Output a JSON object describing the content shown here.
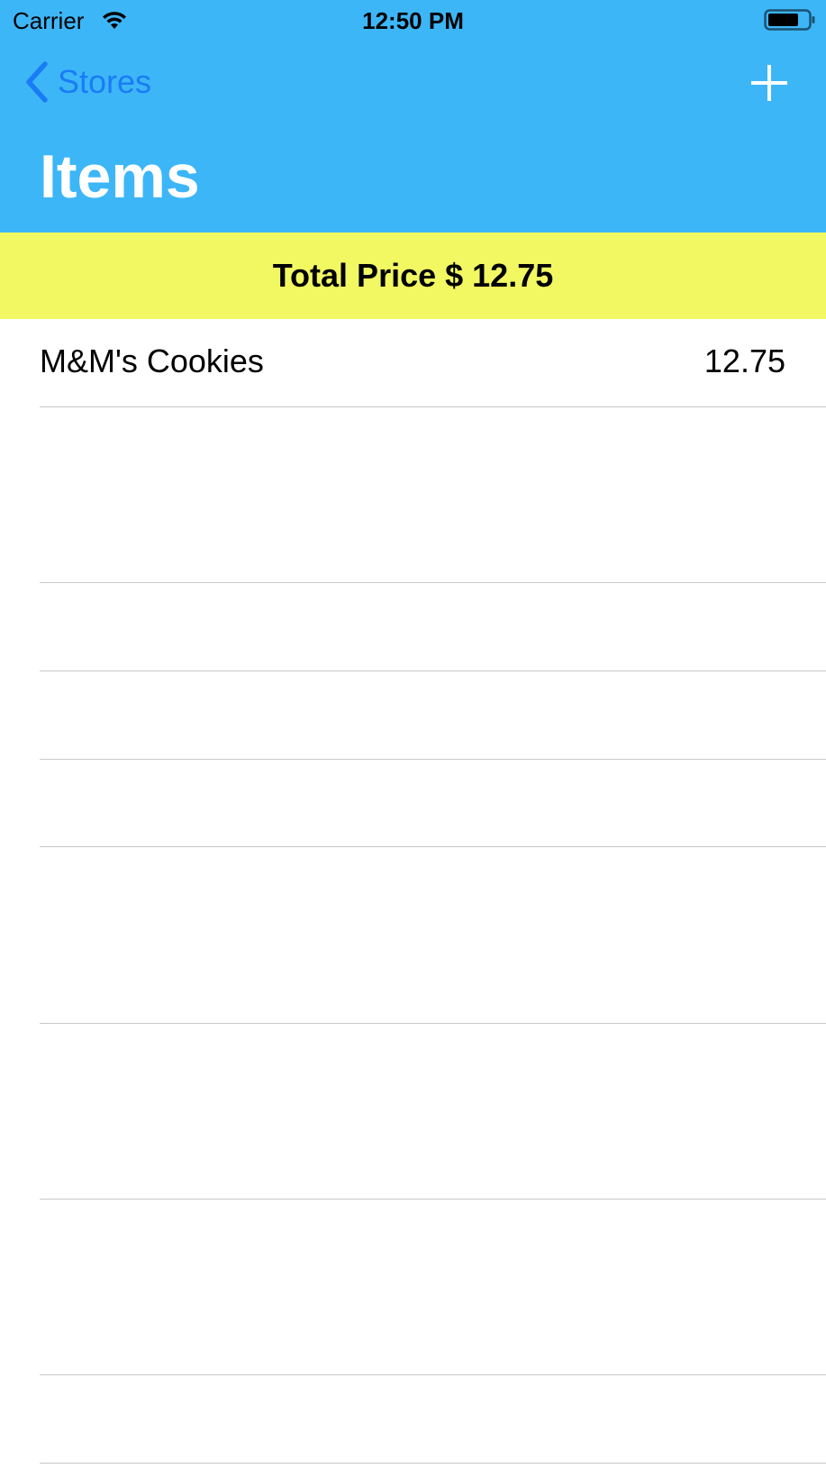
{
  "status_bar": {
    "carrier": "Carrier",
    "time": "12:50 PM"
  },
  "nav": {
    "back_label": "Stores",
    "title": "Items",
    "add_icon": "plus-icon"
  },
  "summary": {
    "total_text": "Total Price $ 12.75"
  },
  "items": [
    {
      "name": "M&M's Cookies",
      "price": "12.75"
    }
  ],
  "colors": {
    "header_background": "#3db6f8",
    "banner_background": "#f2f862",
    "back_tint": "#1a7cf5",
    "title_color": "#ffffff",
    "separator": "#c8c7cc"
  }
}
